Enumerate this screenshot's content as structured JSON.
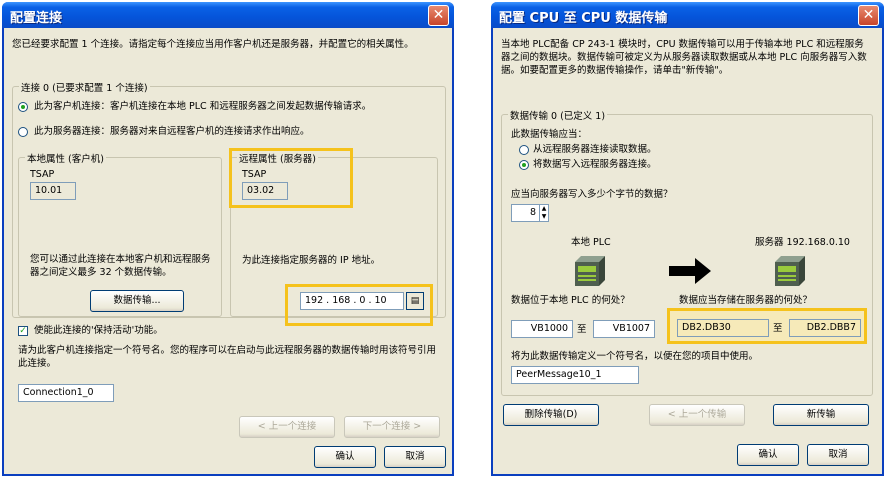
{
  "left_dialog": {
    "title": "配置连接",
    "close_label": "✕",
    "intro": "您已经要求配置 1 个连接。请指定每个连接应当用作客户机还是服务器，并配置它的相关属性。",
    "connection_group": "连接 0 (已要求配置 1 个连接)",
    "client_radio": "此为客户机连接：客户机连接在本地 PLC 和远程服务器之间发起数据传输请求。",
    "server_radio": "此为服务器连接：服务器对来自远程客户机的连接请求作出响应。",
    "local_group": "本地属性 (客户机)",
    "local_tsap_label": "TSAP",
    "local_tsap_value": "10.01",
    "local_note": "您可以通过此连接在本地客户机和远程服务器之间定义最多 32 个数据传输。",
    "data_transfer_button": "数据传输...",
    "remote_group": "远程属性 (服务器)",
    "remote_tsap_label": "TSAP",
    "remote_tsap_value": "03.02",
    "ip_prompt": "为此连接指定服务器的 IP 地址。",
    "ip_value": "192 . 168 .  0  . 10",
    "keepalive_label": "使能此连接的'保持活动'功能。",
    "symbol_prompt": "请为此客户机连接指定一个符号名。您的程序可以在启动与此远程服务器的数据传输时用该符号引用此连接。",
    "symbol_value": "Connection1_0",
    "prev_button": "< 上一个连接",
    "next_button": "下一个连接 >",
    "ok_button": "确认",
    "cancel_button": "取消"
  },
  "right_dialog": {
    "title": "配置 CPU 至 CPU 数据传输",
    "close_label": "✕",
    "intro": "当本地 PLC配备 CP 243-1 模块时，CPU 数据传输可以用于传输本地 PLC 和远程服务器之间的数据块。数据传输可被定义为从服务器读取数据或从本地 PLC 向服务器写入数据。如要配置更多的数据传输操作，请单击\"新传输\"。",
    "transfer_group": "数据传输 0 (已定义 1)",
    "should_label": "此数据传输应当：",
    "read_radio": "从远程服务器连接读取数据。",
    "write_radio": "将数据写入远程服务器连接。",
    "bytes_prompt": "应当向服务器写入多少个字节的数据？",
    "bytes_value": "8",
    "local_plc_label": "本地 PLC",
    "server_label": "服务器 192.168.0.10",
    "local_where": "数据位于本地 PLC 的何处？",
    "server_where": "数据应当存储在服务器的何处？",
    "local_from": "VB1000",
    "to_label_local": "至",
    "local_to": "VB1007",
    "server_from": "DB2.DB30",
    "to_label_server": "至",
    "server_to": "DB2.DBB7",
    "symbol_prompt": "将为此数据传输定义一个符号名，以便在您的项目中使用。",
    "symbol_value": "PeerMessage10_1",
    "delete_button": "删除传输(D)",
    "prev_button": "< 上一个传输",
    "new_button": "新传输",
    "ok_button": "确认",
    "cancel_button": "取消"
  },
  "colors": {
    "titlebar": "#0554d9",
    "dialog_bg": "#ece9d8",
    "highlight": "#f5c21c",
    "selected_radio": "#21a121"
  }
}
